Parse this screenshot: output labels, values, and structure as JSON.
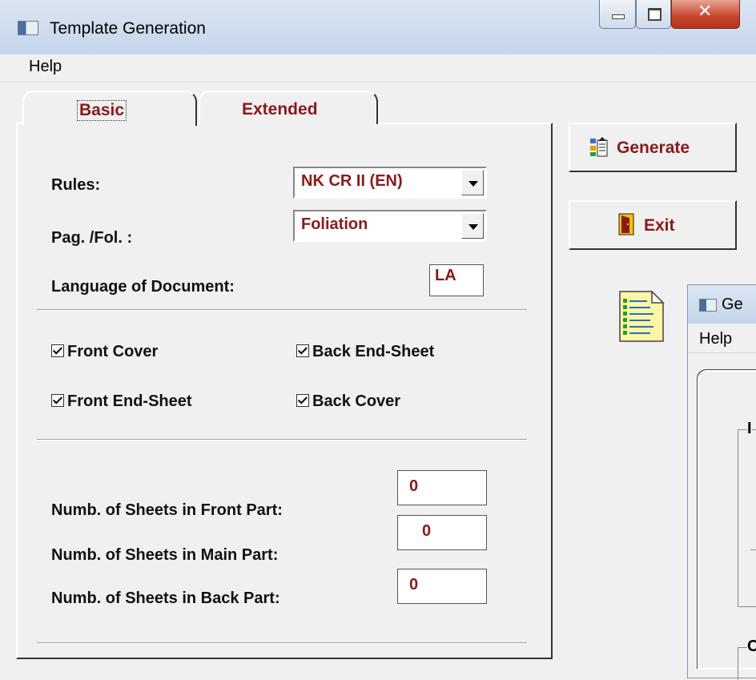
{
  "window": {
    "title": "Template Generation",
    "menu": [
      "Help"
    ],
    "caption_buttons": [
      "minimize-icon",
      "maximize-icon",
      "close-icon"
    ]
  },
  "tabs": [
    {
      "label": "Basic",
      "active": true
    },
    {
      "label": "Extended",
      "active": false
    }
  ],
  "basic": {
    "rules": {
      "label": "Rules:",
      "value": "NK CR II (EN)"
    },
    "pagination": {
      "label": "Pag. /Fol. :",
      "value": "Foliation"
    },
    "language": {
      "label": "Language of Document:",
      "value": "LA"
    },
    "checkboxes": [
      {
        "label": "Front Cover",
        "checked": true
      },
      {
        "label": "Back End-Sheet",
        "checked": true
      },
      {
        "label": "Front End-Sheet",
        "checked": true
      },
      {
        "label": "Back Cover",
        "checked": true
      }
    ],
    "sheets": [
      {
        "label": "Numb. of Sheets in Front Part:",
        "value": "0"
      },
      {
        "label": "Numb. of Sheets in Main Part:",
        "value": "0"
      },
      {
        "label": "Numb. of Sheets in Back Part:",
        "value": "0"
      }
    ]
  },
  "buttons": {
    "generate": {
      "label": "Generate",
      "icon": "generate-icon"
    },
    "exit": {
      "label": "Exit",
      "icon": "exit-door-icon"
    }
  },
  "document_icon": "checklist-document-icon",
  "child_window": {
    "title": "Ge",
    "menu": "Help",
    "group1": "I",
    "group2": "C"
  },
  "colors": {
    "accent_text": "#8b1a1a",
    "title_gradient": "#c4d5ea"
  }
}
